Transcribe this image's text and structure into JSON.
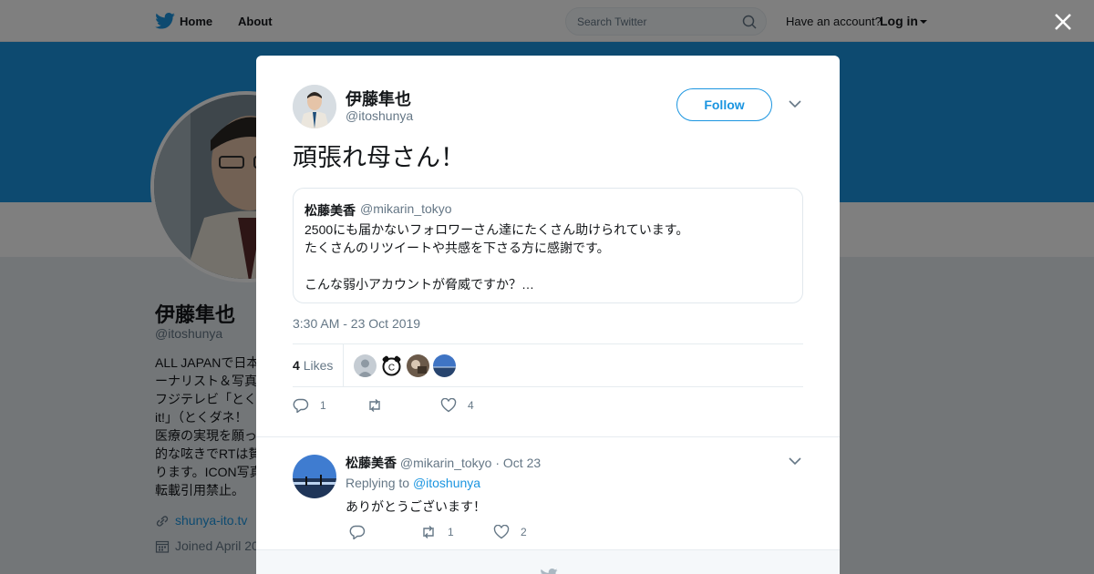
{
  "nav": {
    "home": "Home",
    "about": "About",
    "search_placeholder": "Search Twitter",
    "have_account": "Have an account?",
    "login": "Log in"
  },
  "profile_bg": {
    "name": "伊藤隼也",
    "handle": "@itoshunya",
    "bio_lines": [
      "ALL JAPANで日本",
      "ーナリスト＆写真",
      "フジテレビ「とく",
      "it!」（とくダネ！",
      "医療の実現を願っ",
      "的な呟きでRTは賛",
      "ります。ICON写真",
      "転載引用禁止。"
    ],
    "link": "shunya-ito.tv",
    "joined": "Joined April 20"
  },
  "tweet": {
    "author_name": "伊藤隼也",
    "author_handle": "@itoshunya",
    "follow_label": "Follow",
    "text": "頑張れ母さん！",
    "quote": {
      "name": "松藤美香",
      "handle": "@mikarin_tokyo",
      "lines": [
        "2500にも届かないフォロワーさん達にたくさん助けられています。",
        "たくさんのリツイートや共感を下さる方に感謝です。",
        "",
        "こんな弱小アカウントが脅威ですか？…"
      ]
    },
    "timestamp": "3:30 AM - 23 Oct 2019",
    "likes_count": "4",
    "likes_label": "Likes",
    "reply_count": "1",
    "retweet_count": "",
    "like_count": "4"
  },
  "reply": {
    "name": "松藤美香",
    "handle": "@mikarin_tokyo",
    "date": "Oct 23",
    "replying_to_label": "Replying to",
    "replying_to_handle": "@itoshunya",
    "text": "ありがとうございます！",
    "reply_count": "",
    "retweet_count": "1",
    "like_count": "2"
  },
  "colors": {
    "brand_blue": "#1b95e0",
    "text_primary": "#14171a",
    "text_secondary": "#657786"
  },
  "icons": {
    "logo": "twitter-bird-icon",
    "close": "close-icon",
    "search": "search-icon",
    "reply": "reply-icon",
    "retweet": "retweet-icon",
    "like": "heart-icon",
    "chevron": "chevron-down-icon"
  }
}
